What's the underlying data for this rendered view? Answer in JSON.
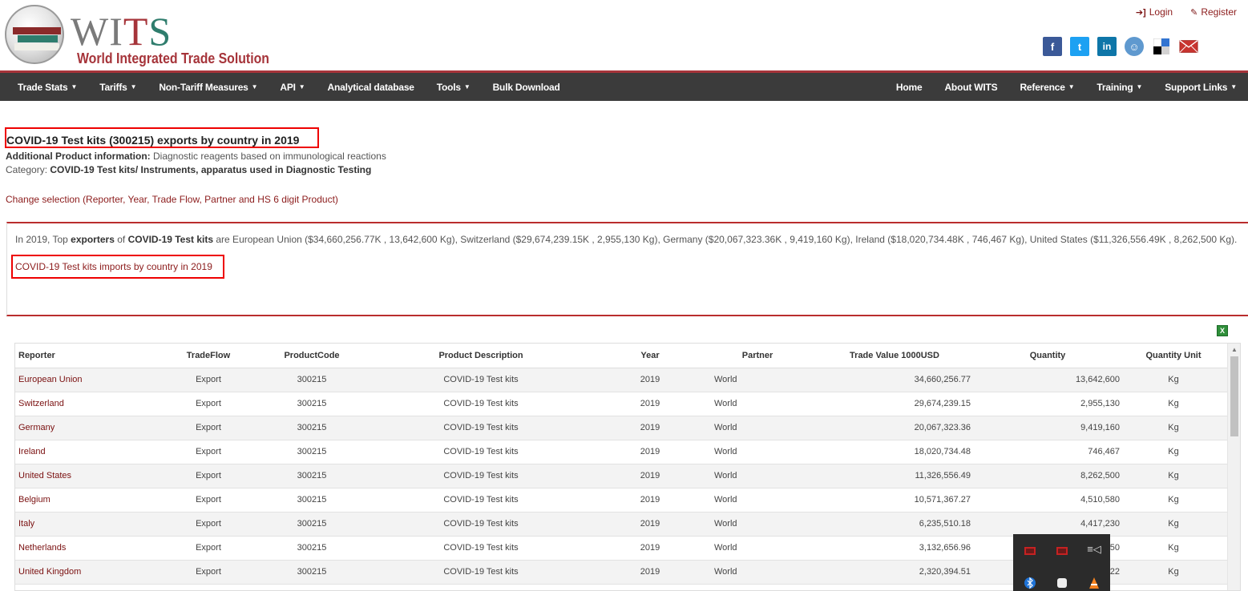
{
  "header": {
    "logo_text": "WITS",
    "logo_subtitle": "World Integrated Trade Solution",
    "login_label": "Login",
    "register_label": "Register",
    "social_icons": [
      "facebook-icon",
      "twitter-icon",
      "linkedin-icon",
      "reddit-icon",
      "delicious-icon",
      "email-icon"
    ]
  },
  "nav": {
    "left": [
      {
        "label": "Trade Stats",
        "dropdown": true
      },
      {
        "label": "Tariffs",
        "dropdown": true
      },
      {
        "label": "Non-Tariff Measures",
        "dropdown": true
      },
      {
        "label": "API",
        "dropdown": true
      },
      {
        "label": "Analytical database",
        "dropdown": false
      },
      {
        "label": "Tools",
        "dropdown": true
      },
      {
        "label": "Bulk Download",
        "dropdown": false
      }
    ],
    "right": [
      {
        "label": "Home",
        "dropdown": false
      },
      {
        "label": "About WITS",
        "dropdown": false
      },
      {
        "label": "Reference",
        "dropdown": true
      },
      {
        "label": "Training",
        "dropdown": true
      },
      {
        "label": "Support Links",
        "dropdown": true
      }
    ]
  },
  "page": {
    "title": "COVID-19 Test kits (300215) exports by country in 2019",
    "additional_info_label": "Additional Product information:",
    "additional_info_value": " Diagnostic reagents based on immunological reactions",
    "category_label": "Category: ",
    "category_value": "COVID-19 Test kits/ Instruments, apparatus used in Diagnostic Testing",
    "change_selection": "Change selection (Reporter, Year, Trade Flow, Partner and HS 6 digit Product)",
    "summary_prefix": "In 2019, Top ",
    "summary_bold1": "exporters",
    "summary_mid": " of ",
    "summary_bold2": "COVID-19 Test kits",
    "summary_rest": " are European Union ($34,660,256.77K , 13,642,600 Kg), Switzerland ($29,674,239.15K , 2,955,130 Kg), Germany ($20,067,323.36K , 9,419,160 Kg), Ireland ($18,020,734.48K , 746,467 Kg), United States ($11,326,556.49K , 8,262,500 Kg).",
    "imports_link": "COVID-19 Test kits imports by country in 2019"
  },
  "table": {
    "columns": [
      "Reporter",
      "TradeFlow",
      "ProductCode",
      "Product Description",
      "Year",
      "Partner",
      "Trade Value 1000USD",
      "Quantity",
      "Quantity Unit"
    ],
    "rows": [
      [
        "European Union",
        "Export",
        "300215",
        "COVID-19 Test kits",
        "2019",
        "World",
        "34,660,256.77",
        "13,642,600",
        "Kg"
      ],
      [
        "Switzerland",
        "Export",
        "300215",
        "COVID-19 Test kits",
        "2019",
        "World",
        "29,674,239.15",
        "2,955,130",
        "Kg"
      ],
      [
        "Germany",
        "Export",
        "300215",
        "COVID-19 Test kits",
        "2019",
        "World",
        "20,067,323.36",
        "9,419,160",
        "Kg"
      ],
      [
        "Ireland",
        "Export",
        "300215",
        "COVID-19 Test kits",
        "2019",
        "World",
        "18,020,734.48",
        "746,467",
        "Kg"
      ],
      [
        "United States",
        "Export",
        "300215",
        "COVID-19 Test kits",
        "2019",
        "World",
        "11,326,556.49",
        "8,262,500",
        "Kg"
      ],
      [
        "Belgium",
        "Export",
        "300215",
        "COVID-19 Test kits",
        "2019",
        "World",
        "10,571,367.27",
        "4,510,580",
        "Kg"
      ],
      [
        "Italy",
        "Export",
        "300215",
        "COVID-19 Test kits",
        "2019",
        "World",
        "6,235,510.18",
        "4,417,230",
        "Kg"
      ],
      [
        "Netherlands",
        "Export",
        "300215",
        "COVID-19 Test kits",
        "2019",
        "World",
        "3,132,656.96",
        "250",
        "Kg"
      ],
      [
        "United Kingdom",
        "Export",
        "300215",
        "COVID-19 Test kits",
        "2019",
        "World",
        "2,320,394.51",
        "922",
        "Kg"
      ]
    ]
  },
  "colors": {
    "accent_red": "#a6343a",
    "nav_bg": "#3b3b3b",
    "link": "#8c1c1c",
    "highlight_box": "#ee0000"
  }
}
